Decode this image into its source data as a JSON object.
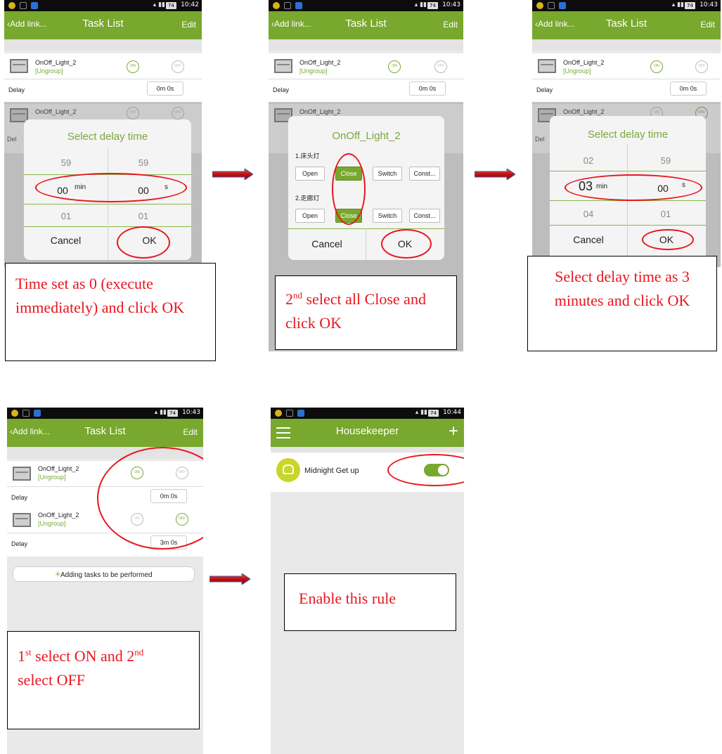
{
  "status_times": [
    "10:42",
    "10:43",
    "10:43",
    "10:43",
    "10:44"
  ],
  "battery": "74",
  "signal": "▴ ▮▮",
  "task_list": {
    "back": "‹Add link...",
    "title": "Task List",
    "edit": "Edit"
  },
  "device": {
    "name": "OnOff_Light_2",
    "group": "[Ungroup]",
    "on": "ON",
    "off": "OFF",
    "delay": "Delay"
  },
  "delays": {
    "zero": "0m 0s",
    "three": "3m 0s"
  },
  "picker": {
    "title": "Select delay time",
    "cancel": "Cancel",
    "ok": "OK",
    "min": "min",
    "s": "s",
    "p1": {
      "min": [
        "59",
        "00",
        "01"
      ],
      "sec": [
        "59",
        "00",
        "01"
      ]
    },
    "p3": {
      "min": [
        "02",
        "03",
        "04"
      ],
      "sec": [
        "59",
        "00",
        "01"
      ]
    }
  },
  "dialog2": {
    "title": "OnOff_Light_2",
    "sec1": "1.床头灯",
    "sec2": "2.走廊灯",
    "options": [
      "Open",
      "Close",
      "Switch",
      "Const..."
    ],
    "cancel": "Cancel",
    "ok": "OK"
  },
  "add_task": "Adding tasks to be performed",
  "housekeeper": {
    "title": "Housekeeper",
    "plus": "+",
    "rule": "Midnight Get up"
  },
  "notes": {
    "n1": "Time set as 0 (execute immediately) and click OK",
    "n2_sup": "nd",
    "n2_pre": "2",
    "n2": " select all Close and click OK",
    "n3": "Select delay time as 3 minutes and click OK",
    "n4_a": "1",
    "n4_a_sup": "st",
    "n4_b": " select ON and 2",
    "n4_b_sup": "nd",
    "n4_c": " select OFF",
    "n5": "Enable this rule"
  },
  "colors": {
    "accent": "#78a82d",
    "annotation": "#e8161e"
  }
}
